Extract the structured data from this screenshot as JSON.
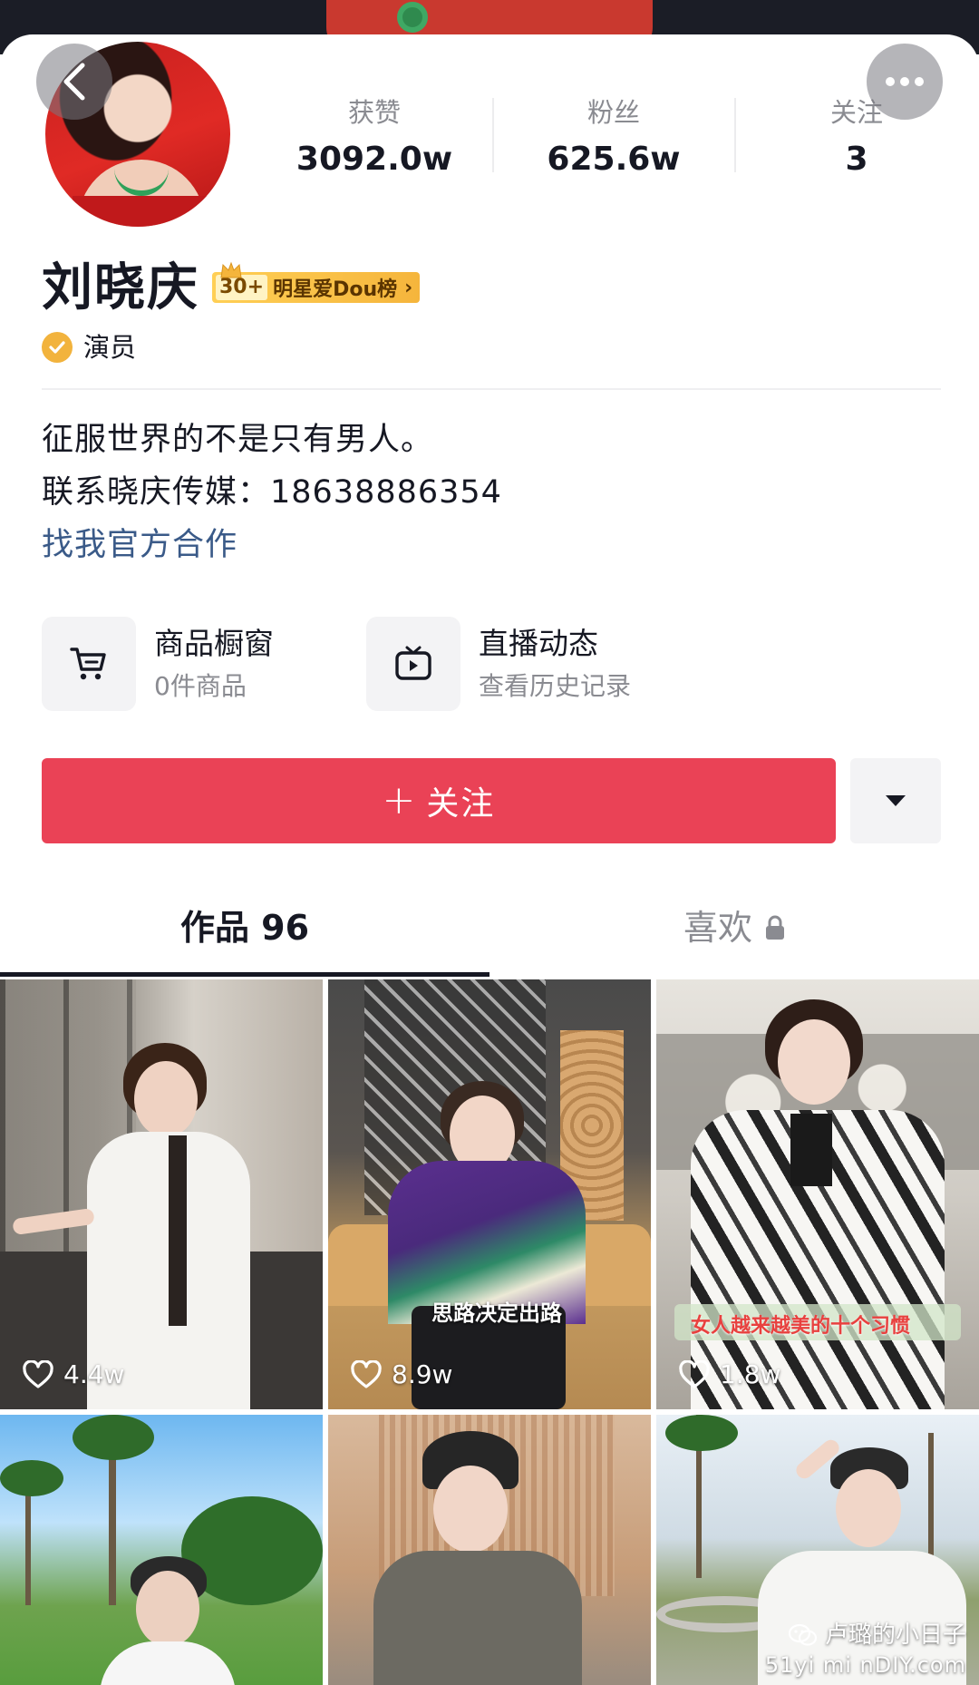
{
  "profile": {
    "name": "刘晓庆",
    "rank_badge": {
      "number": "30+",
      "label": "明星爱Dou榜",
      "chevron": "›"
    },
    "verify_label": "演员",
    "stats": [
      {
        "label": "获赞",
        "value": "3092.0w"
      },
      {
        "label": "粉丝",
        "value": "625.6w"
      },
      {
        "label": "关注",
        "value": "3"
      }
    ],
    "bio_lines": [
      "征服世界的不是只有男人。",
      "联系晓庆传媒：18638886354"
    ],
    "cooperation_link": "找我官方合作"
  },
  "services": [
    {
      "title": "商品橱窗",
      "subtitle": "0件商品",
      "icon": "cart-icon"
    },
    {
      "title": "直播动态",
      "subtitle": "查看历史记录",
      "icon": "live-tv-icon"
    }
  ],
  "actions": {
    "follow_label": "关注",
    "follow_plus": "+"
  },
  "tabs": {
    "works": "作品 96",
    "likes": "喜欢"
  },
  "videos": [
    {
      "likes": "4.4w",
      "caption": ""
    },
    {
      "likes": "8.9w",
      "caption": "思路决定出路"
    },
    {
      "likes": "1.8w",
      "caption": "女人越来越美的十个习惯"
    },
    {
      "likes": "",
      "caption": ""
    },
    {
      "likes": "",
      "caption": ""
    },
    {
      "likes": "",
      "caption": ""
    }
  ],
  "watermark": {
    "line1": "卢璐的小日子",
    "line2": "51yi mi nDIY.com"
  },
  "colors": {
    "follow_red": "#ea4256",
    "link_blue": "#3a5a88",
    "rank_gold": "#f5b53c",
    "verify_gold": "#f2b33d"
  }
}
